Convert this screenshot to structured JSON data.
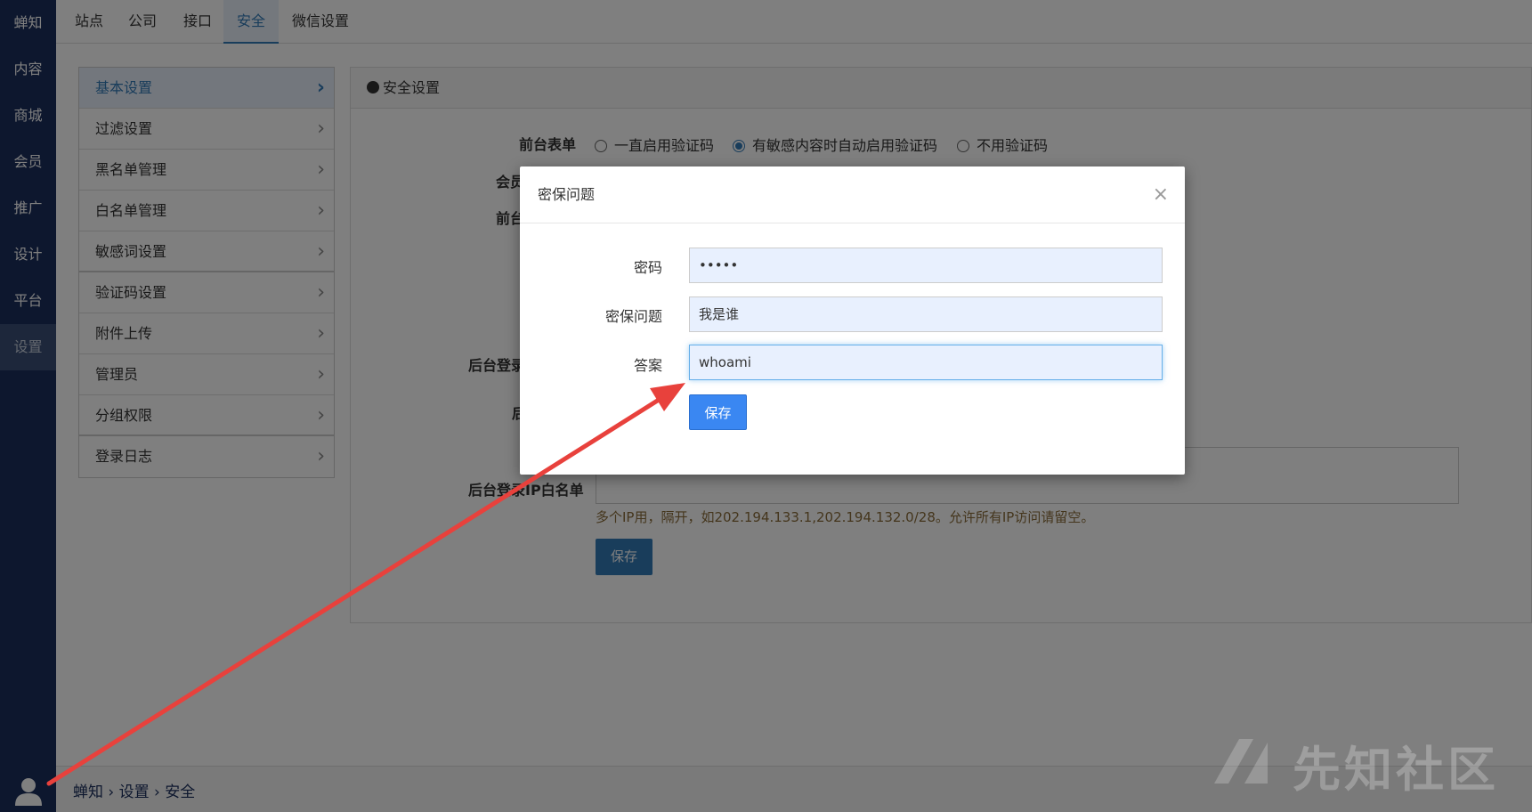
{
  "leftnav": {
    "items": [
      "蝉知",
      "内容",
      "商城",
      "会员",
      "推广",
      "设计",
      "平台",
      "设置"
    ],
    "active_index": 7
  },
  "topbar": {
    "tabs": [
      "站点",
      "公司",
      "接口",
      "安全",
      "微信设置"
    ],
    "active": "安全"
  },
  "menu": {
    "items": [
      "基本设置",
      "过滤设置",
      "黑名单管理",
      "白名单管理",
      "敏感词设置",
      "验证码设置",
      "附件上传",
      "管理员",
      "分组权限",
      "登录日志"
    ],
    "active": "基本设置"
  },
  "panel": {
    "title": "安全设置",
    "front_form_label": "前台表单",
    "radio_options": [
      "一直启用验证码",
      "有敏感内容时自动启用验证码",
      "不用验证码"
    ],
    "radio_selected": 1,
    "label_member": "会员",
    "label_front2": "前台",
    "label_admin_login": "后台登录",
    "label_admin2": "后",
    "label_whitelist": "后台登录IP白名单",
    "help_text": "多个IP用，隔开，如202.194.133.1,202.194.132.0/28。允许所有IP访问请留空。",
    "save_label": "保存"
  },
  "modal": {
    "title": "密保问题",
    "close": "×",
    "password_label": "密码",
    "password_value": "•••••",
    "question_label": "密保问题",
    "question_value": "我是谁",
    "answer_label": "答案",
    "answer_value": "whoami",
    "save_label": "保存"
  },
  "breadcrumb": {
    "items": [
      "蝉知",
      "设置",
      "安全"
    ],
    "separator": "›"
  },
  "watermark": "先知社区",
  "colors": {
    "nav_bg": "#1b2f5d",
    "accent": "#337ab7",
    "modal_button": "#3a87f2",
    "arrow": "#e8413c"
  }
}
